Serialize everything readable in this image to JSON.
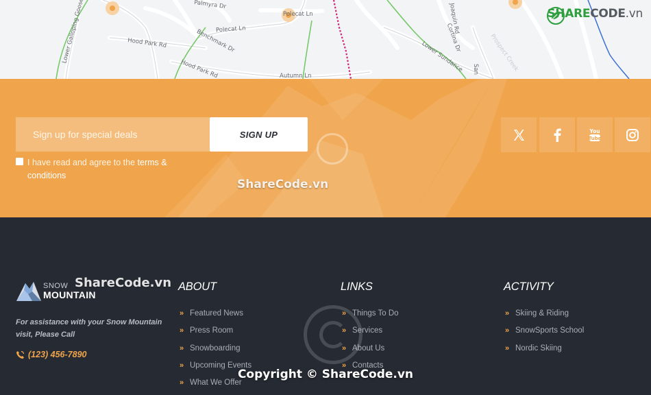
{
  "map": {
    "labels": [
      "Lower Galloping Goose",
      "Palmyra Dr",
      "Polecat Ln",
      "Hood Park Rd",
      "Benchmark Dr",
      "Hood Park Rd",
      "Autumn Ln",
      "Polecat Ln",
      "Lower Sundance",
      "Cortina Dr",
      "Joaquin Rd",
      "Prospect Creek",
      "San"
    ],
    "brand": {
      "share": "SHARE",
      "code": "CODE",
      "vn": ".vn"
    },
    "icons": [
      "leaf-logo-icon",
      "map-marker-icon"
    ]
  },
  "signup": {
    "email_placeholder": "Sign up for special deals",
    "button_label": "SIGN UP",
    "agree_text": "I have read and agree to the ",
    "agree_link": "terms & conditions",
    "watermark": "ShareCode.vn",
    "social": [
      "x-icon",
      "facebook-icon",
      "youtube-icon",
      "instagram-icon"
    ]
  },
  "footer": {
    "logo": {
      "word1": "SNOW",
      "word2": "MOUNTAIN",
      "icon": "mountain-logo-icon"
    },
    "assist_text": "For assistance with your Snow Mountain visit, Please Call",
    "phone": "(123) 456-7890",
    "watermark_top": "ShareCode.vn",
    "copyright": "Copyright © ShareCode.vn",
    "columns": [
      {
        "title": "ABOUT",
        "items": [
          "Featured News",
          "Press Room",
          "Snowboarding",
          "Upcoming Events",
          "What We Offer"
        ]
      },
      {
        "title": "LINKS",
        "items": [
          "Things To Do",
          "Services",
          "About Us",
          "Contacts"
        ]
      },
      {
        "title": "ACTIVITY",
        "items": [
          "Skiing & Riding",
          "SnowSports School",
          "Nordic Skiing"
        ]
      }
    ]
  },
  "colors": {
    "accent": "#f0a44b",
    "footer_bg": "#262b33",
    "brand_green": "#2e9e3f"
  }
}
